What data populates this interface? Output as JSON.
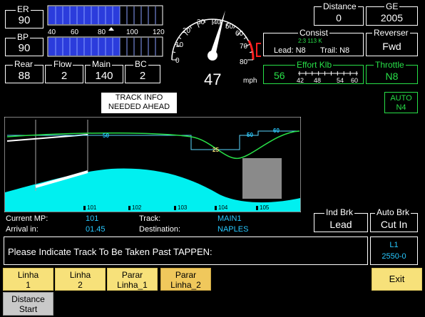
{
  "left": {
    "er": {
      "label": "ER",
      "value": "90",
      "level": 90
    },
    "bp": {
      "label": "BP",
      "value": "90",
      "level": 90
    },
    "scale": [
      "40",
      "60",
      "80",
      "100",
      "120"
    ],
    "rear": {
      "label": "Rear",
      "value": "88"
    },
    "flow": {
      "label": "Flow",
      "value": "2"
    },
    "main": {
      "label": "Main",
      "value": "140"
    },
    "bc": {
      "label": "BC",
      "value": "2"
    }
  },
  "speedometer": {
    "ticks": [
      "0",
      "10",
      "20",
      "30",
      "40",
      "50",
      "60",
      "70",
      "80"
    ],
    "speed": "47",
    "speed_value": 47,
    "unit": "mph"
  },
  "right": {
    "distance": {
      "label": "Distance",
      "value": "0"
    },
    "ge": {
      "label": "GE",
      "value": "2005"
    },
    "consist": {
      "label": "Consist",
      "sub": "2:3 113 K",
      "lead": "Lead: N8",
      "trail": "Trail: N8"
    },
    "reverser": {
      "label": "Reverser",
      "value": "Fwd"
    },
    "effort": {
      "label": "Effort Klb",
      "value": "56",
      "ticks": [
        "42",
        "48",
        "54",
        "60"
      ],
      "level": 56
    },
    "throttle": {
      "label": "Throttle",
      "value": "N8"
    },
    "auto": {
      "line1": "AUTO",
      "line2": "N4"
    }
  },
  "track_info": {
    "line1": "TRACK INFO",
    "line2": "NEEDED AHEAD"
  },
  "profile": {
    "mileposts": [
      "101",
      "102",
      "103",
      "104",
      "105"
    ],
    "speed_limits": [
      "50",
      "25",
      "50",
      "60"
    ]
  },
  "info": {
    "current_mp_label": "Current MP:",
    "current_mp": "101",
    "arrival_label": "Arrival in:",
    "arrival": "01.45",
    "track_label": "Track:",
    "track": "MAIN1",
    "destination_label": "Destination:",
    "destination": "NAPLES"
  },
  "brakes": {
    "ind": {
      "label": "Ind Brk",
      "value": "Lead"
    },
    "auto": {
      "label": "Auto Brk",
      "value": "Cut In"
    }
  },
  "message": "Please Indicate Track To Be Taken Past TAPPEN:",
  "id_box": {
    "line1": "L1",
    "line2": "2550-0"
  },
  "buttons": {
    "linha1": [
      "Linha",
      "1"
    ],
    "linha2": [
      "Linha",
      "2"
    ],
    "parar1": [
      "Parar",
      "Linha_1"
    ],
    "parar2": [
      "Parar",
      "Linha_2"
    ],
    "exit": "Exit",
    "distance": [
      "Distance",
      "Start"
    ]
  },
  "colors": {
    "bar_blue": "#2b3cdc",
    "profile_cyan": "#00f0f0",
    "accent_green": "#28e048",
    "text_cyan": "#27c8ff",
    "button_yellow": "#f7e17a"
  }
}
